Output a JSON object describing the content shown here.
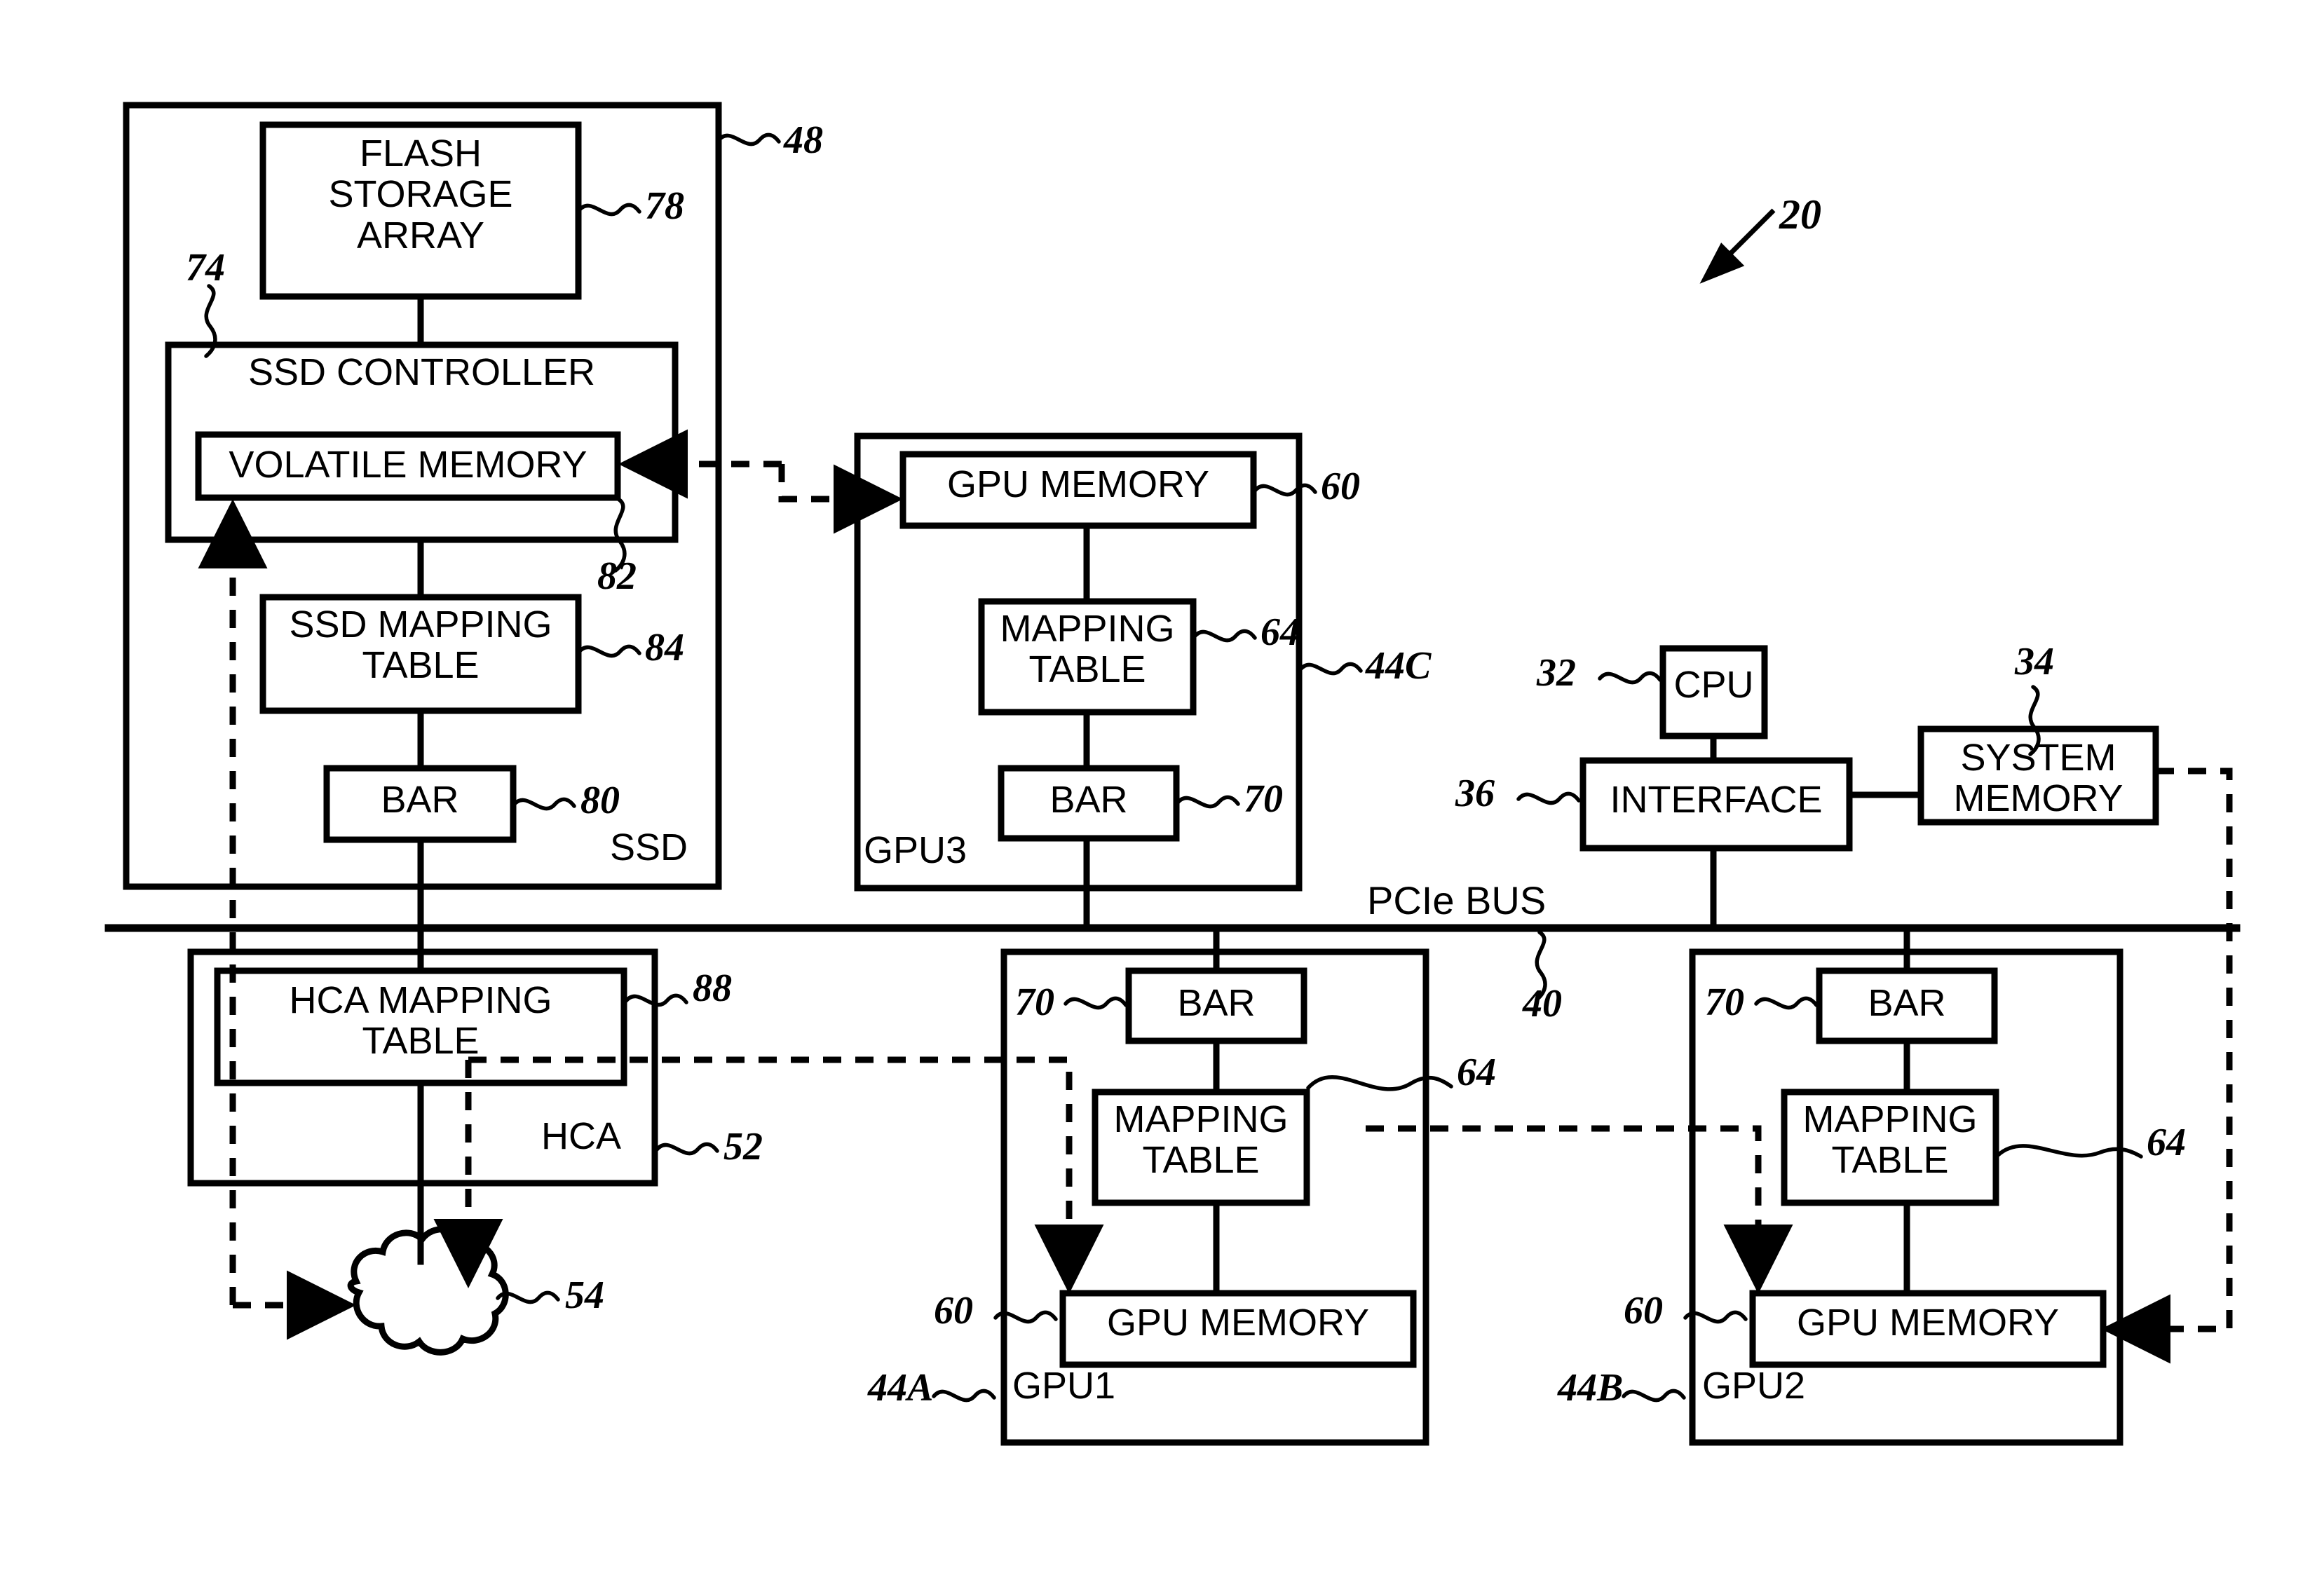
{
  "figure": {
    "title_ref": "20",
    "bus_label": "PCIe BUS",
    "bus_ref": "40"
  },
  "ssd_unit": {
    "container_label": "SSD",
    "container_ref": "48",
    "flash_storage_array": {
      "label": "FLASH\nSTORAGE\nARRAY",
      "ref": "78"
    },
    "ssd_controller": {
      "label": "SSD CONTROLLER",
      "ref": "74"
    },
    "volatile_memory": {
      "label": "VOLATILE MEMORY",
      "ref": "82"
    },
    "ssd_mapping_table": {
      "label": "SSD MAPPING\nTABLE",
      "ref": "84"
    },
    "bar": {
      "label": "BAR",
      "ref": "80"
    }
  },
  "gpu3": {
    "container_label": "GPU3",
    "container_ref": "44C",
    "gpu_memory": {
      "label": "GPU MEMORY",
      "ref": "60"
    },
    "mapping_table": {
      "label": "MAPPING\nTABLE",
      "ref": "64"
    },
    "bar": {
      "label": "BAR",
      "ref": "70"
    }
  },
  "host": {
    "cpu": {
      "label": "CPU",
      "ref": "32"
    },
    "interface": {
      "label": "INTERFACE",
      "ref": "36"
    },
    "system_memory": {
      "label": "SYSTEM\nMEMORY",
      "ref": "34"
    }
  },
  "hca": {
    "container_label": "HCA",
    "container_ref": "52",
    "hca_mapping_table": {
      "label": "HCA MAPPING\nTABLE",
      "ref": "88"
    },
    "network": {
      "label": "",
      "ref": "54"
    }
  },
  "gpu1": {
    "container_label": "GPU1",
    "container_ref": "44A",
    "bar": {
      "label": "BAR",
      "ref": "70"
    },
    "mapping_table": {
      "label": "MAPPING\nTABLE",
      "ref": "64"
    },
    "gpu_memory": {
      "label": "GPU MEMORY",
      "ref": "60"
    }
  },
  "gpu2": {
    "container_label": "GPU2",
    "container_ref": "44B",
    "bar": {
      "label": "BAR",
      "ref": "70"
    },
    "mapping_table": {
      "label": "MAPPING\nTABLE",
      "ref": "64"
    },
    "gpu_memory": {
      "label": "GPU MEMORY",
      "ref": "60"
    }
  },
  "style": {
    "stroke": "#000000",
    "background": "#ffffff"
  }
}
